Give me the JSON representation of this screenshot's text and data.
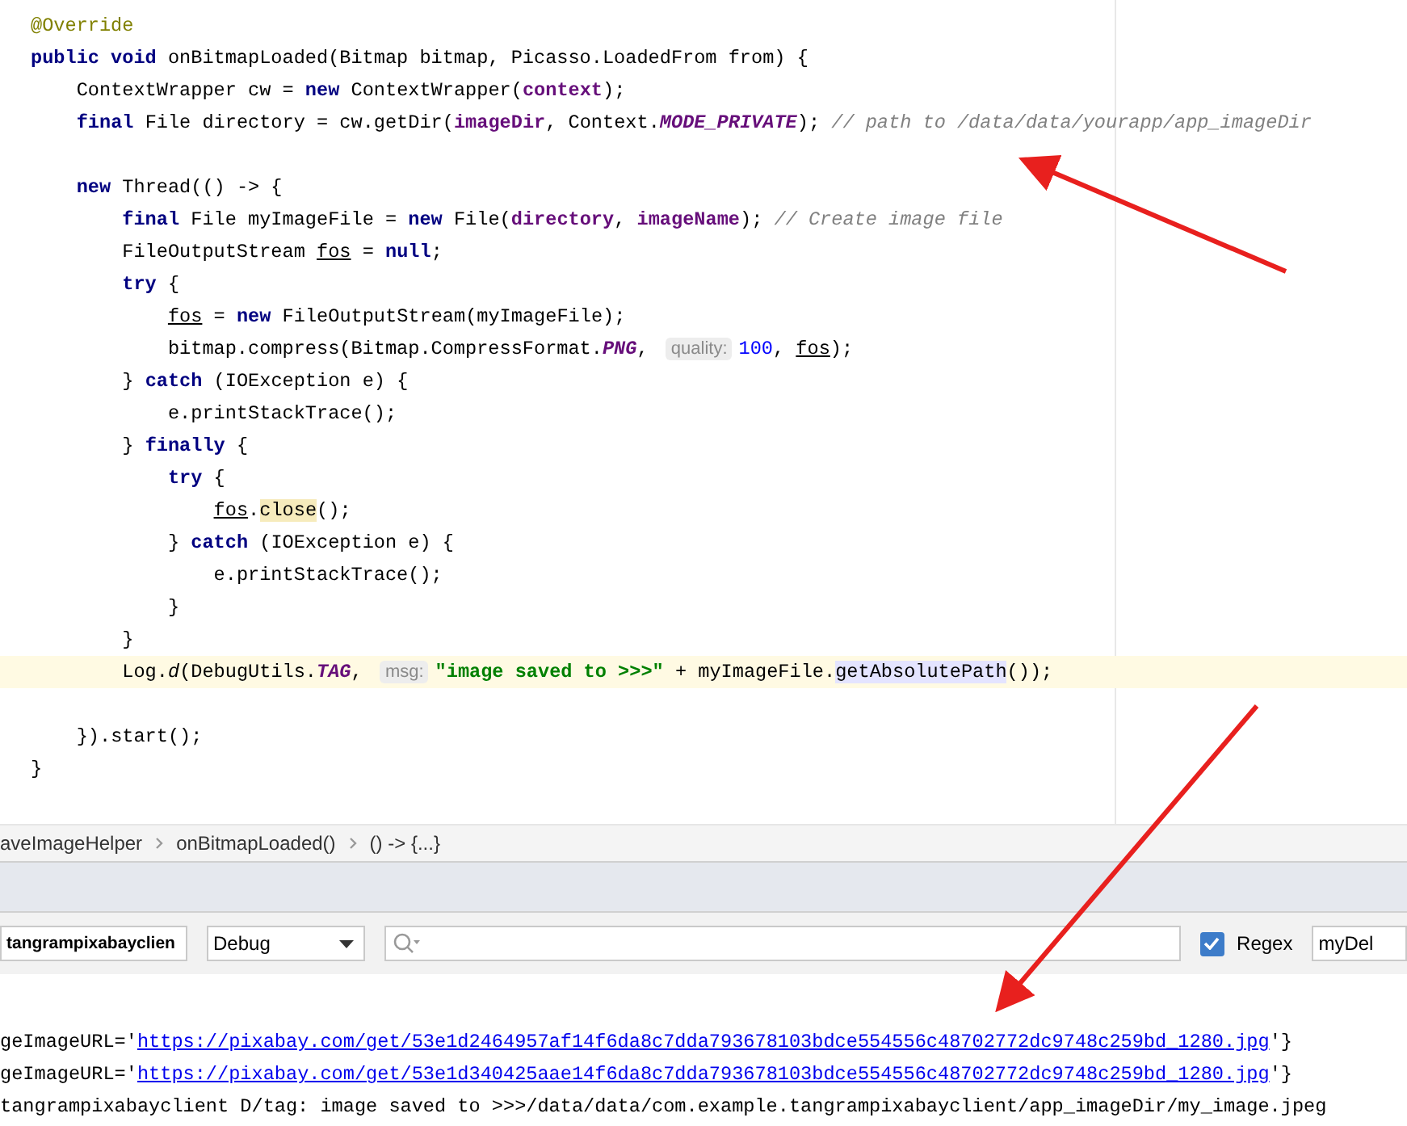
{
  "editor": {
    "lines": [
      {
        "highlighted": false,
        "tokens": [
          {
            "kind": "ann",
            "text": "@Override"
          }
        ]
      },
      {
        "highlighted": false,
        "tokens": [
          {
            "kind": "kw",
            "text": "public void "
          },
          {
            "kind": "t",
            "text": "onBitmapLoaded(Bitmap bitmap, Picasso.LoadedFrom from) {"
          }
        ]
      },
      {
        "highlighted": false,
        "tokens": [
          {
            "kind": "t",
            "text": "    ContextWrapper cw = "
          },
          {
            "kind": "kw",
            "text": "new "
          },
          {
            "kind": "t",
            "text": "ContextWrapper("
          },
          {
            "kind": "f",
            "text": "context"
          },
          {
            "kind": "t",
            "text": ");"
          }
        ]
      },
      {
        "highlighted": false,
        "tokens": [
          {
            "kind": "kw",
            "text": "    final "
          },
          {
            "kind": "t",
            "text": "File directory = cw.getDir("
          },
          {
            "kind": "f",
            "text": "imageDir"
          },
          {
            "kind": "t",
            "text": ", Context."
          },
          {
            "kind": "s",
            "text": "MODE_PRIVATE"
          },
          {
            "kind": "t",
            "text": "); "
          },
          {
            "kind": "c",
            "text": "// path to /data/data/yourapp/app_imageDir"
          }
        ]
      },
      {
        "highlighted": false
      },
      {
        "highlighted": false,
        "tokens": [
          {
            "kind": "kw",
            "text": "    new "
          },
          {
            "kind": "t",
            "text": "Thread(() -> {"
          }
        ]
      },
      {
        "highlighted": false,
        "tokens": [
          {
            "kind": "kw",
            "text": "        final "
          },
          {
            "kind": "t",
            "text": "File myImageFile = "
          },
          {
            "kind": "kw",
            "text": "new "
          },
          {
            "kind": "t",
            "text": "File("
          },
          {
            "kind": "f",
            "text": "directory"
          },
          {
            "kind": "t",
            "text": ", "
          },
          {
            "kind": "f",
            "text": "imageName"
          },
          {
            "kind": "t",
            "text": "); "
          },
          {
            "kind": "c",
            "text": "// Create image file"
          }
        ]
      },
      {
        "highlighted": false,
        "tokens": [
          {
            "kind": "t",
            "text": "        FileOutputStream "
          },
          {
            "kind": "u",
            "text": "fos"
          },
          {
            "kind": "t",
            "text": " = "
          },
          {
            "kind": "kw",
            "text": "null"
          },
          {
            "kind": "t",
            "text": ";"
          }
        ]
      },
      {
        "highlighted": false,
        "tokens": [
          {
            "kind": "kw",
            "text": "        try "
          },
          {
            "kind": "t",
            "text": "{"
          }
        ]
      },
      {
        "highlighted": false,
        "tokens": [
          {
            "kind": "u",
            "text": "            fos"
          },
          {
            "kind": "t",
            "text": " = "
          },
          {
            "kind": "kw",
            "text": "new "
          },
          {
            "kind": "t",
            "text": "FileOutputStream(myImageFile);"
          }
        ]
      },
      {
        "highlighted": false,
        "tokens": [
          {
            "kind": "t",
            "text": "            bitmap.compress(Bitmap.CompressFormat."
          },
          {
            "kind": "s",
            "text": "PNG"
          },
          {
            "kind": "t",
            "text": ", "
          },
          {
            "kind": "h",
            "text": "quality:"
          },
          {
            "kind": "n",
            "text": "100"
          },
          {
            "kind": "t",
            "text": ", "
          },
          {
            "kind": "u",
            "text": "fos"
          },
          {
            "kind": "t",
            "text": ");"
          }
        ]
      },
      {
        "highlighted": false,
        "tokens": [
          {
            "kind": "t",
            "text": "        } "
          },
          {
            "kind": "kw",
            "text": "catch "
          },
          {
            "kind": "t",
            "text": "(IOException e) {"
          }
        ]
      },
      {
        "highlighted": false,
        "tokens": [
          {
            "kind": "t",
            "text": "            e.printStackTrace();"
          }
        ]
      },
      {
        "highlighted": false,
        "tokens": [
          {
            "kind": "t",
            "text": "        } "
          },
          {
            "kind": "kw",
            "text": "finally "
          },
          {
            "kind": "t",
            "text": "{"
          }
        ]
      },
      {
        "highlighted": false,
        "tokens": [
          {
            "kind": "kw",
            "text": "            try "
          },
          {
            "kind": "t",
            "text": "{"
          }
        ]
      },
      {
        "highlighted": false,
        "tokens": [
          {
            "kind": "u",
            "text": "                fos"
          },
          {
            "kind": "t",
            "text": "."
          },
          {
            "kind": "hl",
            "text": "close"
          },
          {
            "kind": "t",
            "text": "();"
          }
        ]
      },
      {
        "highlighted": false,
        "tokens": [
          {
            "kind": "t",
            "text": "            } "
          },
          {
            "kind": "kw",
            "text": "catch "
          },
          {
            "kind": "t",
            "text": "(IOException e) {"
          }
        ]
      },
      {
        "highlighted": false,
        "tokens": [
          {
            "kind": "t",
            "text": "                e.printStackTrace();"
          }
        ]
      },
      {
        "highlighted": false,
        "tokens": [
          {
            "kind": "t",
            "text": "            }"
          }
        ]
      },
      {
        "highlighted": false,
        "tokens": [
          {
            "kind": "t",
            "text": "        }"
          }
        ]
      },
      {
        "highlighted": true,
        "tokens": [
          {
            "kind": "t",
            "text": "        Log."
          },
          {
            "kind": "m",
            "text": "d"
          },
          {
            "kind": "t",
            "text": "(DebugUtils."
          },
          {
            "kind": "s",
            "text": "TAG"
          },
          {
            "kind": "t",
            "text": ", "
          },
          {
            "kind": "h",
            "text": "msg:"
          },
          {
            "kind": "str",
            "text": "\"image saved to >>>\""
          },
          {
            "kind": "t",
            "text": " + myImageFile."
          },
          {
            "kind": "sel",
            "text": "getAbsolutePath"
          },
          {
            "kind": "t",
            "text": "());"
          }
        ]
      },
      {
        "highlighted": false
      },
      {
        "highlighted": false,
        "tokens": [
          {
            "kind": "t",
            "text": "    }).start();"
          }
        ]
      },
      {
        "highlighted": false,
        "tokens": [
          {
            "kind": "t",
            "text": "}"
          }
        ]
      }
    ]
  },
  "breadcrumbs": [
    "aveImageHelper",
    "onBitmapLoaded()",
    "() -> {...}"
  ],
  "logcat": {
    "process": "tangrampixabayclien",
    "log_level": "Debug",
    "regex": {
      "label": "Regex",
      "checked": true
    },
    "filter": "myDel",
    "lines": [
      [
        {
          "kind": "t",
          "text": "geImageURL='"
        },
        {
          "kind": "link",
          "text": "https://pixabay.com/get/53e1d2464957af14f6da8c7dda793678103bdce554556c48702772dc9748c259bd_1280.jpg"
        },
        {
          "kind": "t",
          "text": "'}"
        }
      ],
      [
        {
          "kind": "t",
          "text": "geImageURL='"
        },
        {
          "kind": "link",
          "text": "https://pixabay.com/get/53e1d340425aae14f6da8c7dda793678103bdce554556c48702772dc9748c259bd_1280.jpg"
        },
        {
          "kind": "t",
          "text": "'}"
        }
      ],
      [
        {
          "kind": "t",
          "text": "tangrampixabayclient D/tag: image saved to >>>/data/data/com.example.tangrampixabayclient/app_imageDir/my_image.jpeg"
        }
      ]
    ]
  }
}
